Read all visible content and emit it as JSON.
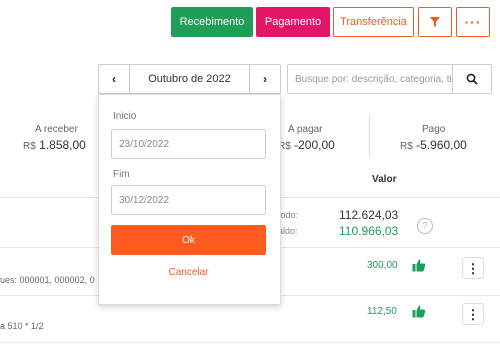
{
  "toolbar": {
    "recebimento": "Recebimento",
    "pagamento": "Pagamento",
    "transferencia": "Transferência",
    "more": "···"
  },
  "month_nav": {
    "prev": "‹",
    "label": "Outubro de 2022",
    "next": "›"
  },
  "search": {
    "placeholder": "Busque por: descrição, categoria, titu"
  },
  "summary": {
    "a_receber": {
      "label": "A receber",
      "currency": "R$",
      "value": "1.858,00"
    },
    "a_pagar": {
      "label": "A pagar",
      "currency": "R$",
      "value": "-200,00"
    },
    "pago": {
      "label": "Pago",
      "currency": "R$",
      "value": "-5.960,00"
    }
  },
  "table": {
    "col_valor": "Valor"
  },
  "period": {
    "label1": "íodo:",
    "value1": "112.624,03",
    "label2": "aldo:",
    "value2": "110.966,03",
    "help": "?"
  },
  "rows": [
    {
      "text": "ues: 000001, 000002, 0",
      "amount": "300,00",
      "kebab": "⋮"
    },
    {
      "text": "a 510 * 1/2",
      "amount": "112,50",
      "kebab": "⋮"
    }
  ],
  "date_popup": {
    "inicio_label": "Inicio",
    "inicio_value": "23/10/2022",
    "fim_label": "Fim",
    "fim_value": "30/12/2022",
    "ok": "Ok",
    "cancelar": "Cancelar"
  },
  "colors": {
    "green": "#1e9e56",
    "pink": "#e31566",
    "orange": "#f05a24",
    "ok_orange": "#ff5a1f"
  },
  "icons": {
    "filter": "filter-icon",
    "search": "search-icon",
    "help": "question-icon",
    "thumb": "thumbs-up-icon",
    "kebab": "kebab-menu-icon"
  }
}
